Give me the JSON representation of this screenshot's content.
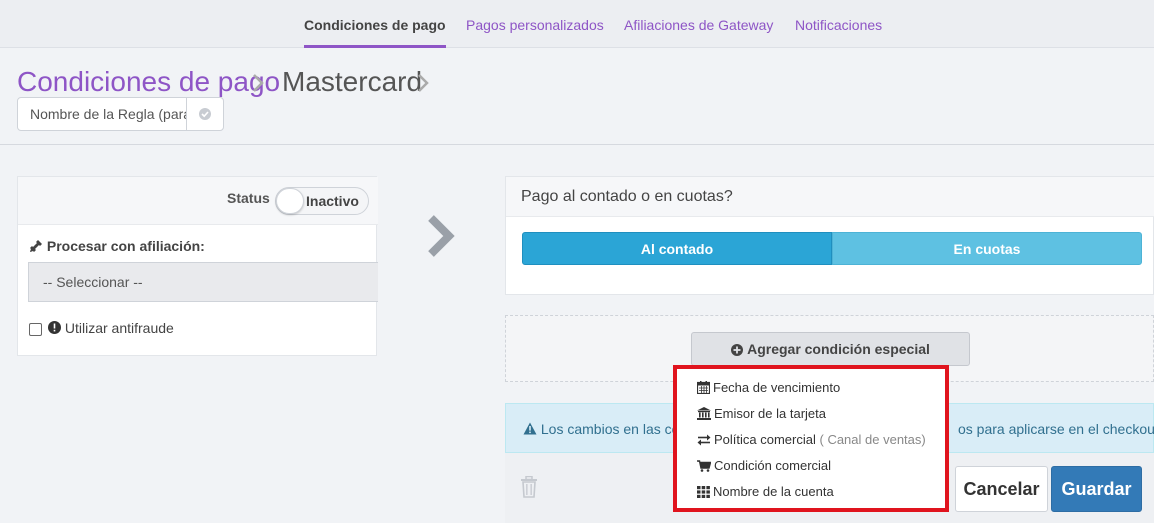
{
  "nav": {
    "tabs": [
      {
        "label": "Condiciones de pago",
        "active": true
      },
      {
        "label": "Pagos personalizados"
      },
      {
        "label": "Afiliaciones de Gateway"
      },
      {
        "label": "Notificaciones"
      }
    ]
  },
  "breadcrumb": {
    "root": "Condiciones de pago",
    "current": "Mastercard"
  },
  "rule_name": {
    "placeholder": "Nombre de la Regla (para a"
  },
  "left_panel": {
    "status_label": "Status",
    "toggle_label": "Inactivo",
    "process_label": "Procesar con afiliación:",
    "select_value": "-- Seleccionar --",
    "antifraud_label": "Utilizar antifraude"
  },
  "payment": {
    "title": "Pago al contado o en cuotas?",
    "options": [
      "Al contado",
      "En cuotas"
    ],
    "selected": "Al contado"
  },
  "add_condition_label": "Agregar condición especial",
  "dropdown": {
    "items": [
      {
        "icon": "calendar-icon",
        "label": "Fecha de vencimiento"
      },
      {
        "icon": "bank-icon",
        "label": "Emisor de la tarjeta"
      },
      {
        "icon": "exchange-icon",
        "label": "Política comercial",
        "extra": "( Canal de ventas)"
      },
      {
        "icon": "cart-icon",
        "label": "Condición comercial"
      },
      {
        "icon": "grid-icon",
        "label": "Nombre de la cuenta"
      }
    ]
  },
  "info": {
    "text_left": "Los cambios en las con",
    "text_right": "os para aplicarse en el checkout."
  },
  "footer": {
    "cancel_label": "Cancelar",
    "save_label": "Guardar"
  },
  "colors": {
    "accent": "#8e55c6",
    "primary": "#337ab7",
    "segment_active": "#2ba5d6",
    "segment_inactive": "#5ec1e2",
    "highlight": "#e0141e"
  }
}
